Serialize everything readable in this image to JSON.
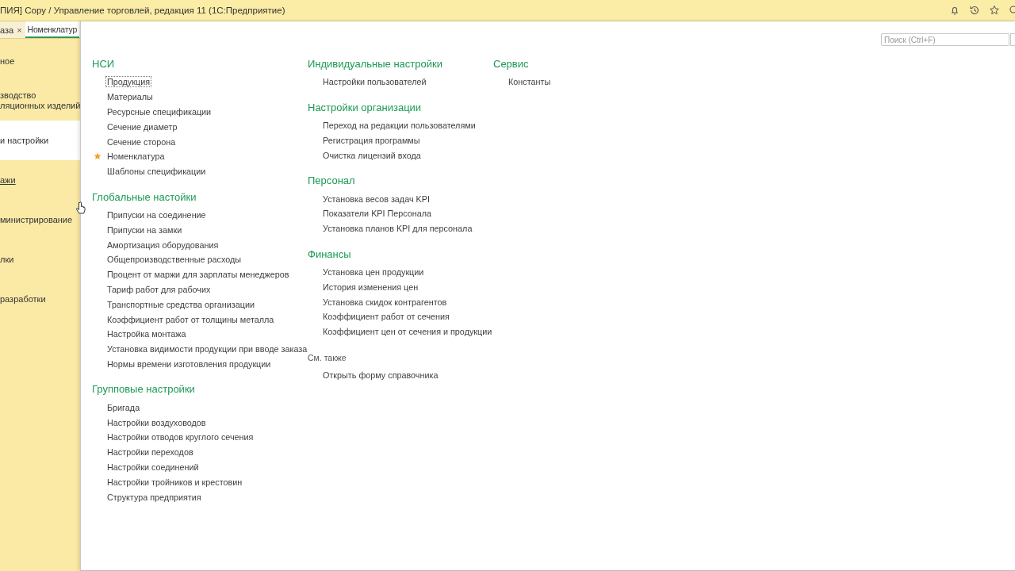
{
  "window": {
    "title": "ПИЯ] Copy / Управление торговлей, редакция 11  (1С:Предприятие)"
  },
  "tabs": [
    {
      "label": "аза",
      "close": "×",
      "selected": false
    },
    {
      "label": "Номенклатур",
      "selected": true
    }
  ],
  "sidebar": {
    "items": [
      {
        "lines": [
          "ное"
        ],
        "selected": false,
        "hovered": false
      },
      {
        "lines": [
          "зводство",
          "ляционных изделий"
        ],
        "selected": false,
        "hovered": false
      },
      {
        "lines": [
          "и настройки"
        ],
        "selected": true,
        "hovered": false
      },
      {
        "lines": [
          "ажи"
        ],
        "selected": false,
        "hovered": true
      },
      {
        "lines": [
          "министрирование"
        ],
        "selected": false,
        "hovered": false
      },
      {
        "lines": [
          "лки"
        ],
        "selected": false,
        "hovered": false
      },
      {
        "lines": [
          "разработки"
        ],
        "selected": false,
        "hovered": false
      }
    ]
  },
  "search": {
    "placeholder": "Поиск (Ctrl+F)"
  },
  "columns": [
    {
      "sections": [
        {
          "kind": "group",
          "title": "НСИ",
          "items": [
            {
              "label": "Продукция",
              "focused": true,
              "favorite": false
            },
            {
              "label": "Материалы",
              "focused": false,
              "favorite": false
            },
            {
              "label": "Ресурсные спецификации",
              "focused": false,
              "favorite": false
            },
            {
              "label": "Сечение диаметр",
              "focused": false,
              "favorite": false
            },
            {
              "label": "Сечение сторона",
              "focused": false,
              "favorite": false
            },
            {
              "label": "Номенклатура",
              "focused": false,
              "favorite": true
            },
            {
              "label": "Шаблоны спецификации",
              "focused": false,
              "favorite": false
            }
          ]
        },
        {
          "kind": "group",
          "title": "Глобальные настойки",
          "items": [
            {
              "label": "Припуски на соединение",
              "focused": false,
              "favorite": false
            },
            {
              "label": "Припуски на замки",
              "focused": false,
              "favorite": false
            },
            {
              "label": "Амортизация оборудования",
              "focused": false,
              "favorite": false
            },
            {
              "label": "Общепроизводственные расходы",
              "focused": false,
              "favorite": false
            },
            {
              "label": "Процент от маржи для зарплаты менеджеров",
              "focused": false,
              "favorite": false
            },
            {
              "label": "Тариф работ для рабочих",
              "focused": false,
              "favorite": false
            },
            {
              "label": "Транспортные средства организации",
              "focused": false,
              "favorite": false
            },
            {
              "label": "Коэффициент работ от толщины металла",
              "focused": false,
              "favorite": false
            },
            {
              "label": "Настройка монтажа",
              "focused": false,
              "favorite": false
            },
            {
              "label": "Установка видимости продукции при вводе заказа",
              "focused": false,
              "favorite": false
            },
            {
              "label": "Нормы времени изготовления продукции",
              "focused": false,
              "favorite": false
            }
          ]
        },
        {
          "kind": "group",
          "title": "Групповые настройки",
          "items": [
            {
              "label": "Бригада",
              "focused": false,
              "favorite": false
            },
            {
              "label": "Настройки воздуховодов",
              "focused": false,
              "favorite": false
            },
            {
              "label": "Настройки отводов круглого сечения",
              "focused": false,
              "favorite": false
            },
            {
              "label": "Настройки переходов",
              "focused": false,
              "favorite": false
            },
            {
              "label": "Настройки соединений",
              "focused": false,
              "favorite": false
            },
            {
              "label": "Настройки тройников и крестовин",
              "focused": false,
              "favorite": false
            },
            {
              "label": "Структура предприятия",
              "focused": false,
              "favorite": false
            }
          ]
        }
      ]
    },
    {
      "sections": [
        {
          "kind": "group",
          "title": "Индивидуальные настройки",
          "items": [
            {
              "label": "Настройки пользователей",
              "focused": false,
              "favorite": false
            }
          ]
        },
        {
          "kind": "group",
          "title": "Настройки организации",
          "items": [
            {
              "label": "Переход на редакции пользователями",
              "focused": false,
              "favorite": false
            },
            {
              "label": "Регистрация программы",
              "focused": false,
              "favorite": false
            },
            {
              "label": "Очистка лицензий входа",
              "focused": false,
              "favorite": false
            }
          ]
        },
        {
          "kind": "group",
          "title": "Персонал",
          "items": [
            {
              "label": "Установка весов задач KPI",
              "focused": false,
              "favorite": false
            },
            {
              "label": "Показатели KPI Персонала",
              "focused": false,
              "favorite": false
            },
            {
              "label": "Установка планов KPI для персонала",
              "focused": false,
              "favorite": false
            }
          ]
        },
        {
          "kind": "group",
          "title": "Финансы",
          "items": [
            {
              "label": "Установка цен продукции",
              "focused": false,
              "favorite": false
            },
            {
              "label": "История изменения цен",
              "focused": false,
              "favorite": false
            },
            {
              "label": "Установка скидок контрагентов",
              "focused": false,
              "favorite": false
            },
            {
              "label": "Коэффициент работ от сечения",
              "focused": false,
              "favorite": false
            },
            {
              "label": "Коэффициент цен от сечения и продукции",
              "focused": false,
              "favorite": false
            }
          ]
        },
        {
          "kind": "see_also",
          "title": "См. также",
          "items": [
            {
              "label": "Открыть форму справочника",
              "focused": false,
              "favorite": false
            }
          ]
        }
      ]
    },
    {
      "sections": [
        {
          "kind": "group",
          "title": "Сервис",
          "items": [
            {
              "label": "Константы",
              "focused": false,
              "favorite": false
            }
          ]
        }
      ]
    }
  ]
}
